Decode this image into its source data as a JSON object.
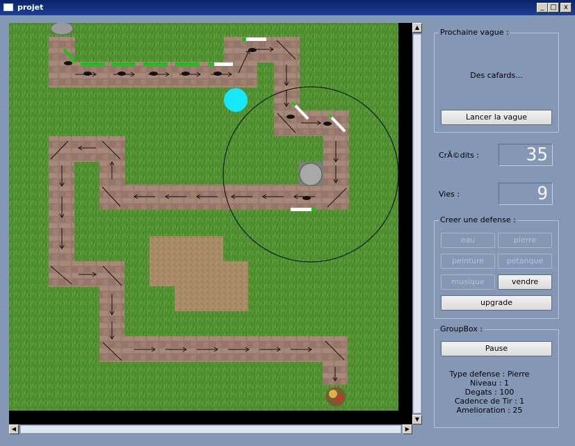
{
  "window": {
    "title": "projet",
    "controls": [
      "_",
      "□",
      "x"
    ]
  },
  "next_wave": {
    "legend": "Prochaine vague :",
    "description": "Des cafards...",
    "launch_label": "Lancer la vague"
  },
  "credits": {
    "label": "CrÃ©dits :",
    "value": "35"
  },
  "lives": {
    "label": "Vies :",
    "value": "9"
  },
  "create_defense": {
    "legend": "Creer une defense :",
    "buttons": {
      "eau": "eau",
      "pierre": "pierre",
      "peinture": "peinture",
      "petanque": "petanque",
      "musique": "musique",
      "vendre": "vendre",
      "upgrade": "upgrade"
    }
  },
  "groupbox": {
    "legend": "GroupBox :",
    "pause_label": "Pause",
    "type": "Type defense : Pierre",
    "level": "Niveau : 1",
    "damage": "Degats : 100",
    "rate": "Cadence de Tir : 1",
    "upgrade_cost": "Amelioration : 25"
  },
  "colors": {
    "grass": "#4f8f2f",
    "path": "#9e8070",
    "sand": "#a88a66",
    "health": "#19c219",
    "tower_range": "#000000"
  },
  "icons": {
    "path_arrows": "arrow-icon",
    "enemy": "ant-icon",
    "base": "flower-pot-icon"
  }
}
